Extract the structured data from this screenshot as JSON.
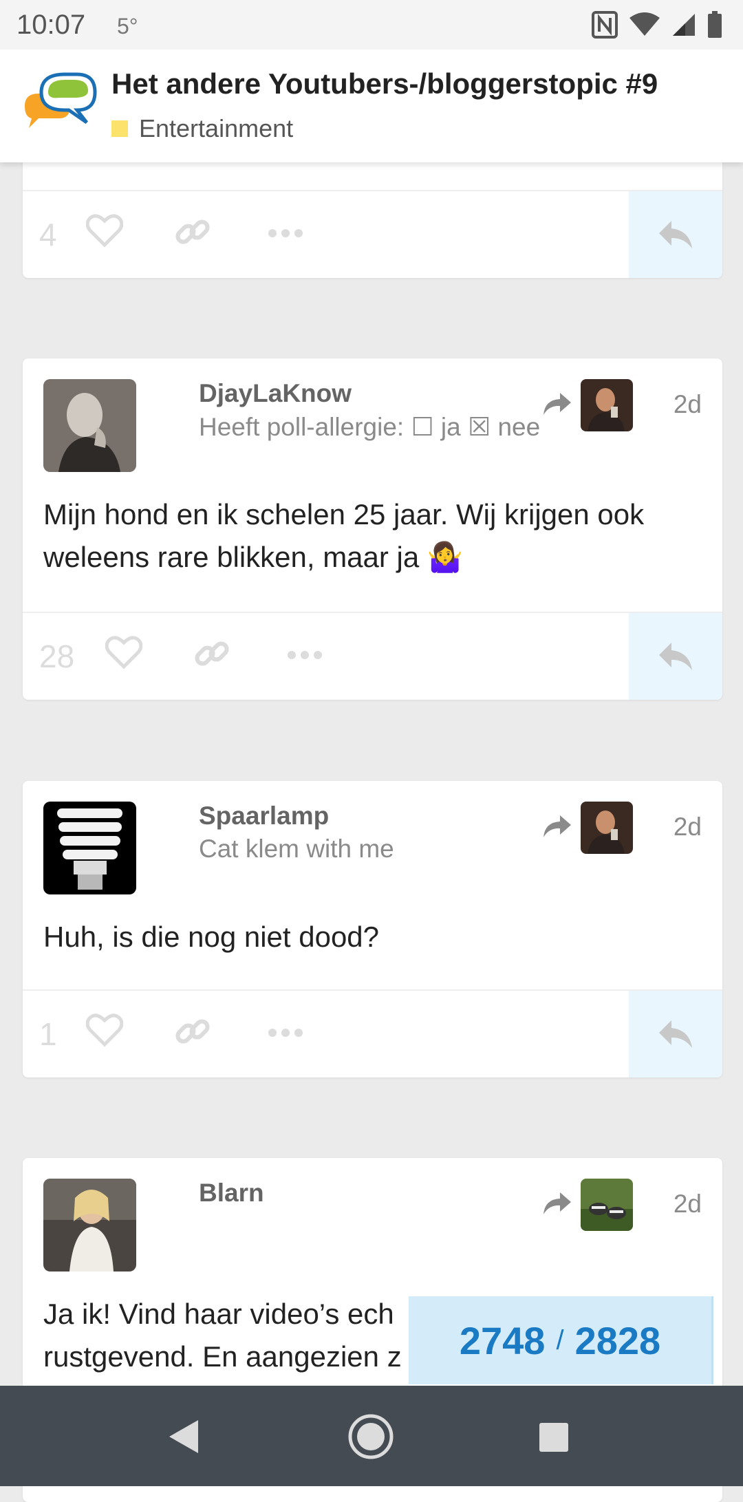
{
  "status_bar": {
    "time": "10:07",
    "temperature": "5°",
    "icons": [
      "nfc-icon",
      "wifi-icon",
      "signal-icon",
      "battery-icon"
    ]
  },
  "header": {
    "title": "Het andere Youtubers-/bloggerstopic #9",
    "category": "Entertainment",
    "category_color": "#fbe36b"
  },
  "posts": [
    {
      "likes": "4"
    },
    {
      "username": "DjayLaKnow",
      "user_title": "Heeft poll-allergie: ☐ ja ☒ nee",
      "date": "2d",
      "body": "Mijn hond en ik schelen 25 jaar. Wij krijgen ook weleens rare blikken, maar ja 🤷‍♀️",
      "likes": "28"
    },
    {
      "username": "Spaarlamp",
      "user_title": "Cat klem with me",
      "date": "2d",
      "body": "Huh, is die nog niet dood?",
      "likes": "1"
    },
    {
      "username": "Blarn",
      "user_title": "",
      "date": "2d",
      "body": "Ja ik! Vind haar video’s ech rustgevend. En aangezien z"
    }
  ],
  "progress": {
    "current": "2748",
    "total": "2828",
    "separator": "/"
  },
  "colors": {
    "accent": "#1a7ac4",
    "reply_bg": "#e9f6fd",
    "navbar": "#444b53"
  }
}
